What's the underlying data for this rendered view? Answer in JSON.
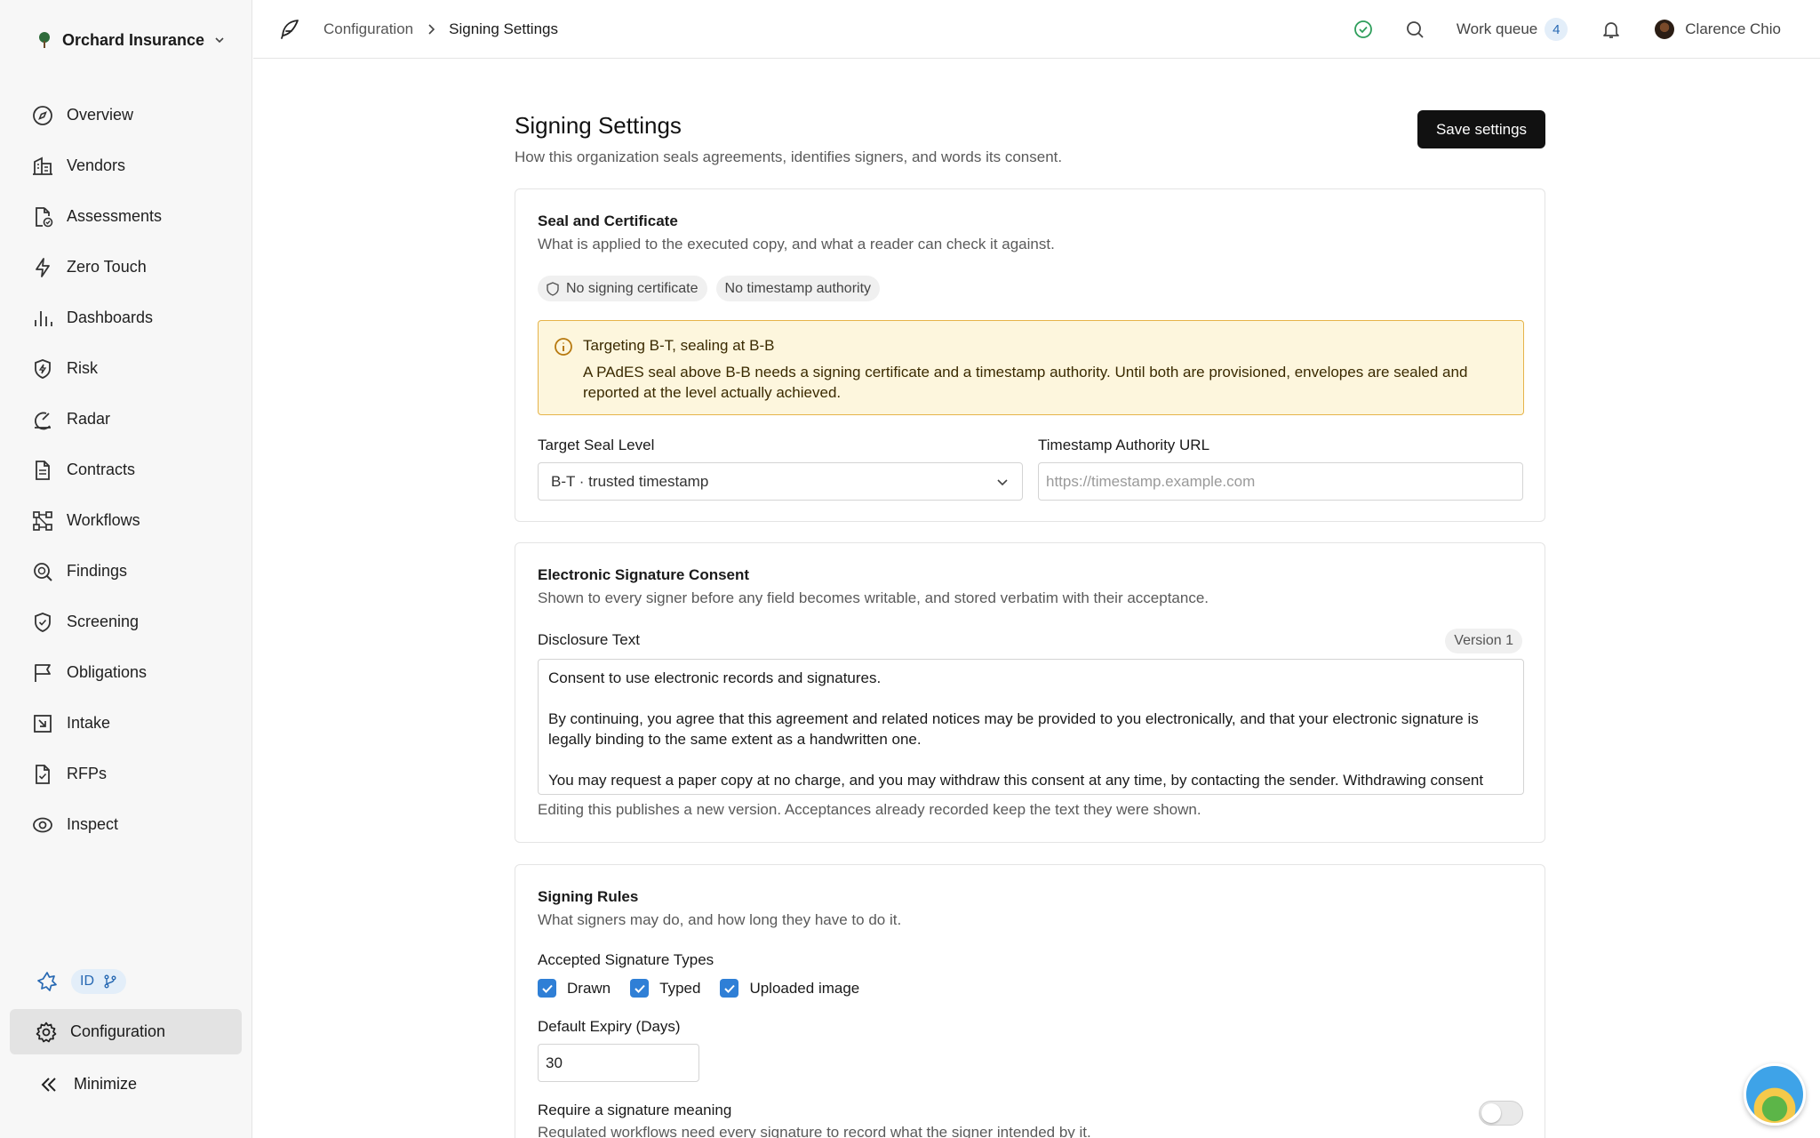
{
  "org": {
    "name": "Orchard Insurance"
  },
  "nav": {
    "items": [
      {
        "label": "Overview"
      },
      {
        "label": "Vendors"
      },
      {
        "label": "Assessments"
      },
      {
        "label": "Zero Touch"
      },
      {
        "label": "Dashboards"
      },
      {
        "label": "Risk"
      },
      {
        "label": "Radar"
      },
      {
        "label": "Contracts"
      },
      {
        "label": "Workflows"
      },
      {
        "label": "Findings"
      },
      {
        "label": "Screening"
      },
      {
        "label": "Obligations"
      },
      {
        "label": "Intake"
      },
      {
        "label": "RFPs"
      },
      {
        "label": "Inspect"
      }
    ],
    "id_badge": "ID",
    "configuration": "Configuration",
    "minimize": "Minimize"
  },
  "breadcrumb": {
    "parent": "Configuration",
    "current": "Signing Settings"
  },
  "topbar": {
    "work_queue_label": "Work queue",
    "work_queue_count": "4",
    "user_name": "Clarence Chio"
  },
  "page": {
    "title": "Signing Settings",
    "subtitle": "How this organization seals agreements, identifies signers, and words its consent.",
    "save_label": "Save settings"
  },
  "seal": {
    "title": "Seal and Certificate",
    "subtitle": "What is applied to the executed copy, and what a reader can check it against.",
    "chip_certificate": "No signing certificate",
    "chip_timestamp": "No timestamp authority",
    "alert_title": "Targeting B-T, sealing at B-B",
    "alert_body": "A PAdES seal above B-B needs a signing certificate and a timestamp authority. Until both are provisioned, envelopes are sealed and reported at the level actually achieved.",
    "target_label": "Target Seal Level",
    "target_value": "B-T · trusted timestamp",
    "tsa_label": "Timestamp Authority URL",
    "tsa_placeholder": "https://timestamp.example.com"
  },
  "consent": {
    "title": "Electronic Signature Consent",
    "subtitle": "Shown to every signer before any field becomes writable, and stored verbatim with their acceptance.",
    "disclosure_label": "Disclosure Text",
    "version": "Version 1",
    "disclosure_text": "Consent to use electronic records and signatures.\n\nBy continuing, you agree that this agreement and related notices may be provided to you electronically, and that your electronic signature is legally binding to the same extent as a handwritten one.\n\nYou may request a paper copy at no charge, and you may withdraw this consent at any time, by contacting the sender. Withdrawing consent does not affect the validity of anything you have already signed.",
    "hint": "Editing this publishes a new version. Acceptances already recorded keep the text they were shown."
  },
  "rules": {
    "title": "Signing Rules",
    "subtitle": "What signers may do, and how long they have to do it.",
    "types_label": "Accepted Signature Types",
    "types": [
      {
        "label": "Drawn",
        "checked": true
      },
      {
        "label": "Typed",
        "checked": true
      },
      {
        "label": "Uploaded image",
        "checked": true
      }
    ],
    "expiry_label": "Default Expiry (Days)",
    "expiry_value": "30",
    "meaning_label": "Require a signature meaning",
    "meaning_hint": "Regulated workflows need every signature to record what the signer intended by it.",
    "meaning_enabled": false
  },
  "colors": {
    "accent": "#2f7fd6",
    "primary_button": "#111111",
    "warning_border": "#e6b44a",
    "warning_bg": "#fdf6dd",
    "status_ok": "#2e9e5b"
  },
  "icons": {
    "org": "tree-icon",
    "status": "check-circle-icon",
    "search": "search-icon",
    "notifications": "bell-icon",
    "brand": "feather-icon"
  }
}
